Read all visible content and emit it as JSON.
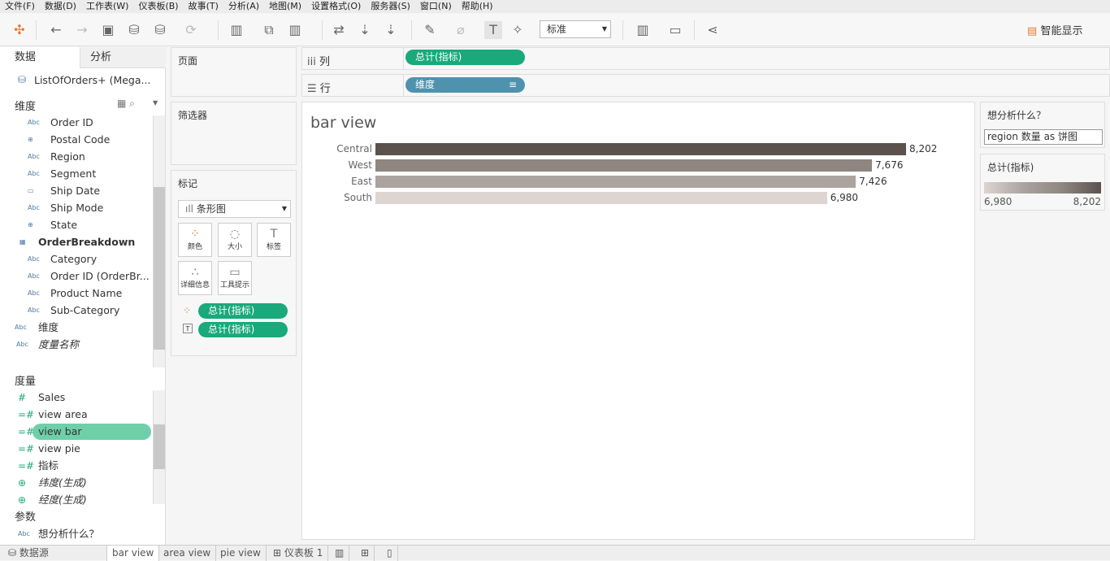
{
  "menu": [
    "文件(F)",
    "数据(D)",
    "工作表(W)",
    "仪表板(B)",
    "故事(T)",
    "分析(A)",
    "地图(M)",
    "设置格式(O)",
    "服务器(S)",
    "窗口(N)",
    "帮助(H)"
  ],
  "toolbar": {
    "fit": "标准",
    "smart_show": "智能显示"
  },
  "left": {
    "tab_data": "数据",
    "tab_analysis": "分析",
    "datasource": "ListOfOrders+ (Mega...",
    "dim_header": "维度",
    "dimensions": [
      {
        "type": "Abc",
        "name": "Order ID"
      },
      {
        "type": "globe",
        "name": "Postal Code"
      },
      {
        "type": "Abc",
        "name": "Region"
      },
      {
        "type": "Abc",
        "name": "Segment"
      },
      {
        "type": "date",
        "name": "Ship Date"
      },
      {
        "type": "Abc",
        "name": "Ship Mode"
      },
      {
        "type": "globe",
        "name": "State"
      }
    ],
    "table2": "OrderBreakdown",
    "dimensions2": [
      {
        "type": "Abc",
        "name": "Category"
      },
      {
        "type": "Abc",
        "name": "Order ID (OrderBr..."
      },
      {
        "type": "Abc",
        "name": "Product Name"
      },
      {
        "type": "Abc",
        "name": "Sub-Category"
      }
    ],
    "calc_dim": "维度",
    "measure_names": "度量名称",
    "meas_header": "度量",
    "measures": [
      {
        "type": "#",
        "name": "Sales"
      },
      {
        "type": "=#",
        "name": "view area"
      },
      {
        "type": "=#",
        "name": "view bar"
      },
      {
        "type": "=#",
        "name": "view pie"
      },
      {
        "type": "=#",
        "name": "指标"
      },
      {
        "type": "globe",
        "name": "纬度(生成)"
      },
      {
        "type": "globe",
        "name": "经度(生成)"
      }
    ],
    "param_header": "参数",
    "param": "想分析什么？"
  },
  "cards": {
    "pages": "页面",
    "filters": "筛选器",
    "marks": "标记",
    "mark_type": "条形图",
    "color": "颜色",
    "size": "大小",
    "label": "标签",
    "detail": "详细信息",
    "tooltip": "工具提示",
    "pill_color": "总计(指标)",
    "pill_label": "总计(指标)"
  },
  "shelves": {
    "cols_label": "列",
    "rows_label": "行",
    "col_pill": "总计(指标)",
    "row_pill": "维度"
  },
  "chart_data": {
    "type": "bar",
    "title": "bar view",
    "categories": [
      "Central",
      "West",
      "East",
      "South"
    ],
    "values": [
      8202,
      7676,
      7426,
      6980
    ],
    "value_labels": [
      "8,202",
      "7,676",
      "7,426",
      "6,980"
    ],
    "colors": [
      "#5b524e",
      "#8e8681",
      "#aba39f",
      "#dcd5d1"
    ],
    "xlim": [
      0,
      8202
    ]
  },
  "right": {
    "param_title": "想分析什么？",
    "param_value": "region 数量 as 饼图",
    "legend_title": "总计(指标)",
    "legend_min": "6,980",
    "legend_max": "8,202"
  },
  "tabs": {
    "datasource": "数据源",
    "sheets": [
      "bar view",
      "area view",
      "pie view"
    ],
    "dashboard": "仪表板 1"
  }
}
